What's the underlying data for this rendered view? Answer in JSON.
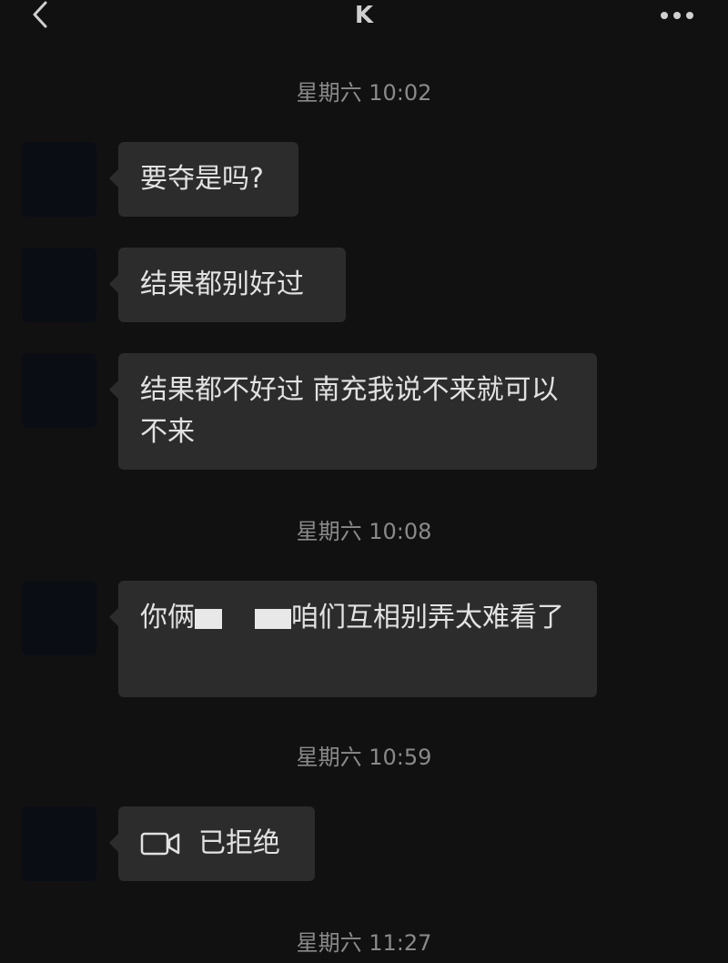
{
  "header": {
    "title": "K"
  },
  "timestamps": {
    "t1": "星期六 10:02",
    "t2": "星期六 10:08",
    "t3": "星期六 10:59",
    "t4": "星期六 11:27"
  },
  "messages": [
    {
      "text": "要夺是吗?"
    },
    {
      "text": "结果都别好过"
    },
    {
      "text": "结果都不好过 南充我说不来就可以不来"
    },
    {
      "text_before": "你俩",
      "text_after": "咱们互相别弄太难看了"
    },
    {
      "call_status": "已拒绝",
      "icon": "video-call-icon"
    }
  ],
  "colors": {
    "background": "#111111",
    "bubble": "#2c2c2c",
    "text": "#e2e2e2",
    "timestamp": "#8a8a8a"
  }
}
